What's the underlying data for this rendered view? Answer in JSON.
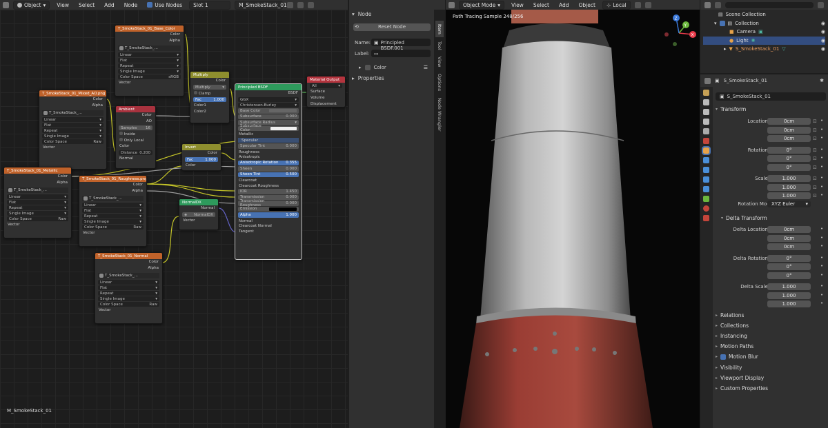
{
  "colors": {
    "accent": "#4772b3",
    "tex_header": "#c0622a",
    "conv_header": "#8e8e2e",
    "shader_header": "#2e9a5c",
    "output_header": "#b4343e",
    "socket_yellow": "#c7c729",
    "socket_grey": "#a1a1a1",
    "socket_green": "#63c763",
    "socket_purple": "#6363c7"
  },
  "ne_header": {
    "mode": "Object",
    "menus": [
      "View",
      "Select",
      "Add",
      "Node"
    ],
    "use_nodes": "Use Nodes",
    "slot": "Slot 1",
    "material": "M_SmokeStack_01"
  },
  "ne_footer": "M_SmokeStack_01",
  "nodes": {
    "basecolor": {
      "title": "T_SmokeStack_01_Base_Color",
      "img": "T_SmokeStack_...",
      "outs": [
        "Color",
        "Alpha"
      ],
      "opts": [
        "Linear",
        "Flat",
        "Repeat",
        "Single Image"
      ],
      "cs_label": "Color Space",
      "cs_val": "sRGB",
      "vec": "Vector"
    },
    "mixedao": {
      "title": "T_SmokeStack_01_Mixed_AO.png",
      "img": "T_SmokeStack_...",
      "outs": [
        "Color",
        "Alpha"
      ],
      "opts": [
        "Linear",
        "Flat",
        "Repeat",
        "Single Image"
      ],
      "cs_label": "Color Space",
      "cs_val": "Raw",
      "vec": "Vector"
    },
    "metallic": {
      "title": "T_SmokeStack_01_Metallic",
      "img": "T_SmokeStack_...",
      "outs": [
        "Color",
        "Alpha"
      ],
      "opts": [
        "Linear",
        "Flat",
        "Repeat",
        "Single Image"
      ],
      "cs_label": "Color Space",
      "cs_val": "Raw",
      "vec": "Vector"
    },
    "roughness": {
      "title": "T_SmokeStack_01_Roughness.png",
      "img": "T_SmokeStack_...",
      "outs": [
        "Color",
        "Alpha"
      ],
      "opts": [
        "Linear",
        "Flat",
        "Repeat",
        "Single Image"
      ],
      "cs_label": "Color Space",
      "cs_val": "Raw",
      "vec": "Vector"
    },
    "normal": {
      "title": "T_SmokeStack_01_Normal",
      "img": "T_SmokeStack_...",
      "outs": [
        "Color",
        "Alpha"
      ],
      "opts": [
        "Linear",
        "Flat",
        "Repeat",
        "Single Image"
      ],
      "cs_label": "Color Space",
      "cs_val": "Raw",
      "vec": "Vector"
    },
    "multiply": {
      "title": "Multiply",
      "out": "Color",
      "op": "Multiply",
      "clamp": "Clamp",
      "fac_label": "Fac",
      "fac_val": "1.000",
      "in1": "Color1",
      "in2": "Color2"
    },
    "ambient": {
      "title": "Ambient",
      "outs": [
        "Color",
        "AO"
      ],
      "samples_label": "Samples",
      "samples_val": "16",
      "inside": "Inside",
      "onlylocal": "Only Local",
      "in_color": "Color",
      "dist_label": "Distance",
      "dist_val": "0.200",
      "in_normal": "Normal"
    },
    "invert": {
      "title": "Invert",
      "out": "Color",
      "fac_label": "Fac",
      "fac_val": "1.000",
      "in_color": "Color"
    },
    "normaldx": {
      "title": "NormalDX",
      "out": "Normal",
      "group": "NormalDX",
      "in_vec": "Vector"
    },
    "bsdf": {
      "title": "Principled BSDF",
      "out": "BSDF",
      "dist": "GGX",
      "sss": "Christensen-Burley",
      "inputs": [
        {
          "label": "Base Color",
          "val": "",
          "kind": "color"
        },
        {
          "label": "Subsurface",
          "val": "0.000",
          "kind": "num"
        },
        {
          "label": "Subsurface Radius",
          "val": "",
          "kind": "drop"
        },
        {
          "label": "Subsurface Color",
          "val": "",
          "kind": "white"
        },
        {
          "label": "Metallic",
          "val": "",
          "kind": "plain"
        },
        {
          "label": "Specular",
          "val": "",
          "kind": "plainblue"
        },
        {
          "label": "Specular Tint",
          "val": "0.000",
          "kind": "num"
        },
        {
          "label": "Roughness",
          "val": "",
          "kind": "plain"
        },
        {
          "label": "Anisotropic",
          "val": "",
          "kind": "plain"
        },
        {
          "label": "Anisotropic Rotation",
          "val": "0.355",
          "kind": "blue"
        },
        {
          "label": "Sheen",
          "val": "0.000",
          "kind": "num"
        },
        {
          "label": "Sheen Tint",
          "val": "0.500",
          "kind": "blue"
        },
        {
          "label": "Clearcoat",
          "val": "",
          "kind": "plain"
        },
        {
          "label": "Clearcoat Roughness",
          "val": "",
          "kind": "plain"
        },
        {
          "label": "IOR",
          "val": "1.450",
          "kind": "num"
        },
        {
          "label": "Transmission",
          "val": "0.000",
          "kind": "num"
        },
        {
          "label": "Transmission Roughness",
          "val": "0.000",
          "kind": "num"
        },
        {
          "label": "Emission",
          "val": "",
          "kind": "black"
        },
        {
          "label": "Alpha",
          "val": "1.000",
          "kind": "blue"
        },
        {
          "label": "Normal",
          "val": "",
          "kind": "plain"
        },
        {
          "label": "Clearcoat Normal",
          "val": "",
          "kind": "plain"
        },
        {
          "label": "Tangent",
          "val": "",
          "kind": "plain"
        }
      ]
    },
    "matout": {
      "title": "Material Output",
      "target": "All",
      "ins": [
        "Surface",
        "Volume",
        "Displacement"
      ]
    }
  },
  "npanel": {
    "section": "Node",
    "reset": "Reset Node",
    "name_label": "Name:",
    "name_val": "Principled BSDF.001",
    "label_label": "Label:",
    "color": "Color",
    "properties": "Properties"
  },
  "ntabs": [
    "Item",
    "Tool",
    "View",
    "Options",
    "Node Wrangler"
  ],
  "vp": {
    "menus": [
      "View",
      "Select",
      "Add",
      "Object"
    ],
    "mode": "Object Mode",
    "transform": "Local",
    "status": "Path Tracing Sample 248/256",
    "gizmo": {
      "x": "X",
      "y": "Y",
      "z": "Z"
    }
  },
  "outliner": {
    "items": [
      "Scene Collection",
      "Collection",
      "Camera",
      "Light",
      "S_SmokeStack_01"
    ]
  },
  "props": {
    "object": "S_SmokeStack_01",
    "name": "S_SmokeStack_01",
    "transform": "Transform",
    "rows": [
      {
        "label": "Location X",
        "val": "0cm"
      },
      {
        "label": "Y",
        "val": "0cm"
      },
      {
        "label": "Z",
        "val": "0cm"
      },
      {
        "label": "Rotation X",
        "val": "0°"
      },
      {
        "label": "Y",
        "val": "0°"
      },
      {
        "label": "Z",
        "val": "0°"
      },
      {
        "label": "Scale X",
        "val": "1.000"
      },
      {
        "label": "Y",
        "val": "1.000"
      },
      {
        "label": "Z",
        "val": "1.000"
      }
    ],
    "rotmode_label": "Rotation Mode",
    "rotmode_val": "XYZ Euler",
    "delta": "Delta Transform",
    "drows": [
      {
        "label": "Delta Location X",
        "val": "0cm"
      },
      {
        "label": "Y",
        "val": "0cm"
      },
      {
        "label": "Z",
        "val": "0cm"
      },
      {
        "label": "Delta Rotation X",
        "val": "0°"
      },
      {
        "label": "Y",
        "val": "0°"
      },
      {
        "label": "Z",
        "val": "0°"
      },
      {
        "label": "Delta Scale X",
        "val": "1.000"
      },
      {
        "label": "Y",
        "val": "1.000"
      },
      {
        "label": "Z",
        "val": "1.000"
      }
    ],
    "sections": [
      "Relations",
      "Collections",
      "Instancing",
      "Motion Paths",
      "Motion Blur",
      "Visibility",
      "Viewport Display",
      "Custom Properties"
    ]
  }
}
